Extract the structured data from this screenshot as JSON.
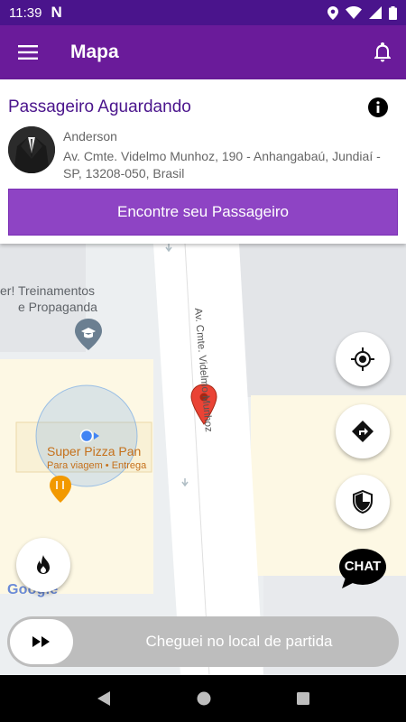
{
  "status_bar": {
    "time": "11:39",
    "notification_letter": "N"
  },
  "app_bar": {
    "title": "Mapa",
    "menu_icon": "hamburger-menu-icon",
    "bell_icon": "bell-icon"
  },
  "card": {
    "title": "Passageiro Aguardando",
    "passenger_name": "Anderson",
    "passenger_address": "Av. Cmte. Videlmo Munhoz, 190 - Anhangabaú, Jundiaí - SP, 13208-050, Brasil",
    "find_button_label": "Encontre seu Passageiro"
  },
  "map": {
    "street_name": "Av. Cmte. Videlmo Munhoz",
    "poi_1_line1": "er! Treinamentos",
    "poi_1_line2": "e Propaganda",
    "poi_2_name": "Super Pizza Pan",
    "poi_2_sub": "Para viagem • Entrega",
    "google_logo": "Google"
  },
  "fabs": {
    "locate": "my-location-icon",
    "directions": "directions-icon",
    "security": "shield-icon",
    "flame": "flame-icon",
    "chat_label": "CHAT"
  },
  "arrive": {
    "label": "Cheguei no local de partida"
  },
  "colors": {
    "status_bar": "#4a148c",
    "app_bar": "#6a1b9a",
    "button": "#8e44c4",
    "title": "#4a148c"
  }
}
